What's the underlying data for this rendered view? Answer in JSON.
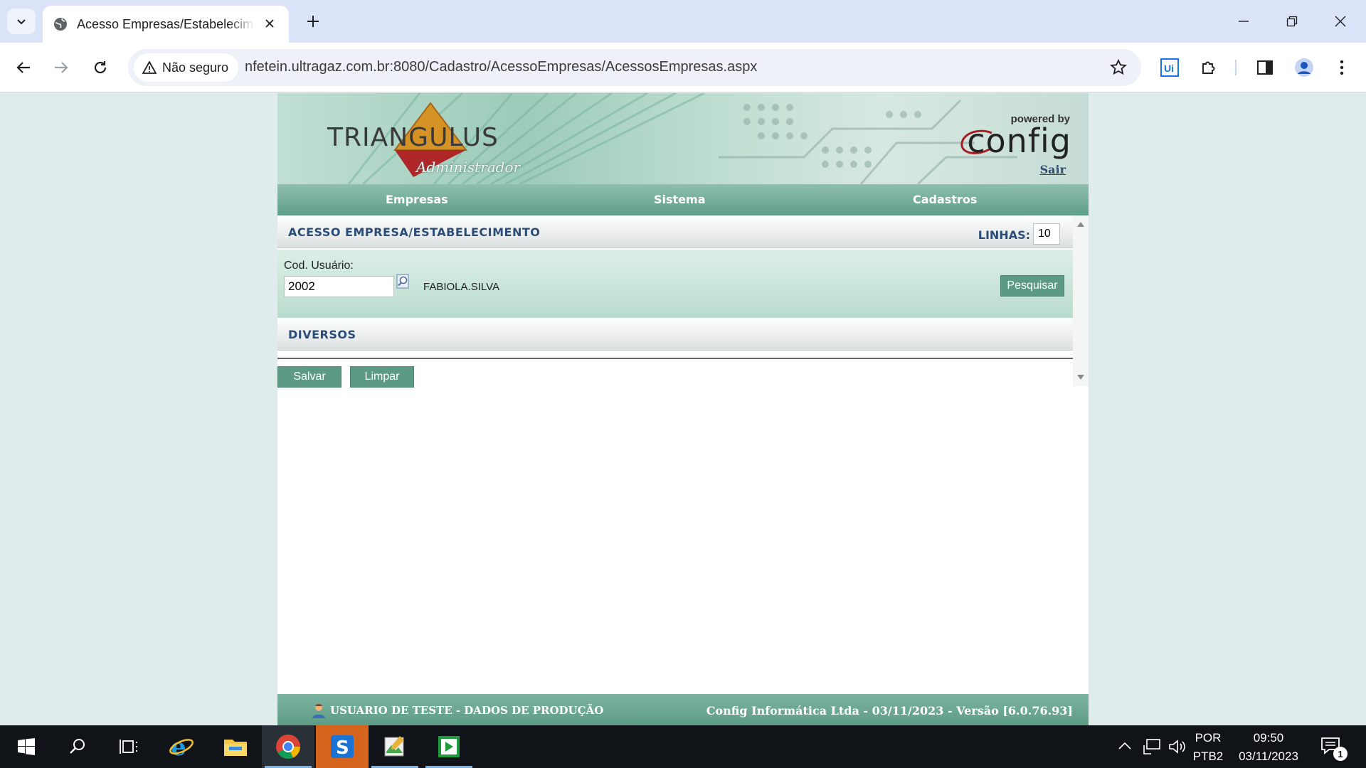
{
  "browser": {
    "tab_title": "Acesso Empresas/Estabelecimentos",
    "security_label": "Não seguro",
    "url": "nfetein.ultragaz.com.br:8080/Cadastro/AcessoEmpresas/AcessosEmpresas.aspx"
  },
  "header": {
    "logo_text": "TRIANGULUS",
    "logo_subtitle": "Administrador",
    "powered_by": "powered by",
    "config_logo": "config",
    "logout_label": "Sair"
  },
  "menu": {
    "items": [
      "Empresas",
      "Sistema",
      "Cadastros"
    ]
  },
  "access_section": {
    "title": "ACESSO EMPRESA/ESTABELECIMENTO",
    "lines_label": "LINHAS:",
    "lines_value": "10",
    "user_code_label": "Cod. Usuário:",
    "user_code_value": "2002",
    "user_name": "FABIOLA.SILVA",
    "search_button": "Pesquisar"
  },
  "diversos_section": {
    "title": "DIVERSOS"
  },
  "actions": {
    "save_label": "Salvar",
    "clear_label": "Limpar"
  },
  "footer": {
    "left_text": "USUARIO DE TESTE - DADOS DE PRODUÇÃO",
    "right_text": "Config Informática Ltda - 03/11/2023 - Versão [6.0.76.93]"
  },
  "taskbar": {
    "language_top": "POR",
    "language_bottom": "PTB2",
    "time": "09:50",
    "date": "03/11/2023",
    "notification_count": "1"
  },
  "colors": {
    "menu_green": "#5f9e88",
    "button_green": "#5c9a84",
    "section_title_blue": "#2c4c78"
  }
}
